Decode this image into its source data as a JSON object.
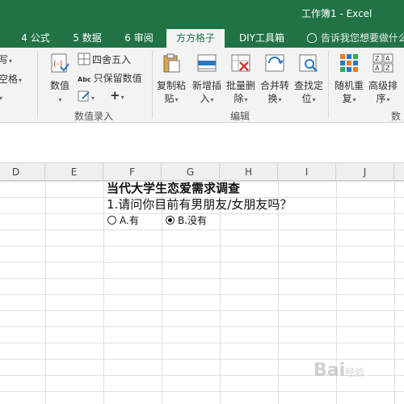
{
  "window": {
    "title": "工作簿1 - Excel"
  },
  "tabs": [
    {
      "label": "4 公式"
    },
    {
      "label": "5 数据"
    },
    {
      "label": "6 审阅"
    },
    {
      "label": "方方格子",
      "active": true
    },
    {
      "label": "DIY工具箱"
    }
  ],
  "tell_me": {
    "text": "告诉我您想要做什么"
  },
  "ribbon": {
    "left_partial": {
      "item1": "写",
      "item2": "空格"
    },
    "number_entry": {
      "group_label": "数值录入",
      "value_button": "数值",
      "round_label": "四舍五入",
      "keep_value_label": "只保留数值",
      "edit_icon_caret": "▾",
      "plus_label": "+"
    },
    "edit": {
      "group_label": "编辑",
      "buttons": [
        {
          "line1": "复制粘",
          "line2": "贴"
        },
        {
          "line1": "新增插",
          "line2": "入"
        },
        {
          "line1": "批量删",
          "line2": "除"
        },
        {
          "line1": "合并转",
          "line2": "换"
        },
        {
          "line1": "查找定",
          "line2": "位"
        }
      ]
    },
    "next_group": {
      "group_label": "数",
      "buttons": [
        {
          "line1": "随机重",
          "line2": "复"
        },
        {
          "line1": "高级排",
          "line2": "序"
        }
      ]
    }
  },
  "columns": [
    "D",
    "E",
    "F",
    "G",
    "H",
    "I",
    "J"
  ],
  "sheet": {
    "survey_title": "当代大学生恋爱需求调查",
    "question": "1.请问你目前有男朋友/女朋友吗？",
    "options": [
      {
        "label": "A.有",
        "selected": false
      },
      {
        "label": "B.没有",
        "selected": true
      }
    ]
  },
  "watermark": {
    "text": "Bai",
    "suffix": "经验"
  },
  "colors": {
    "excel_green": "#217346",
    "ribbon_bg": "#f3f3f3"
  }
}
